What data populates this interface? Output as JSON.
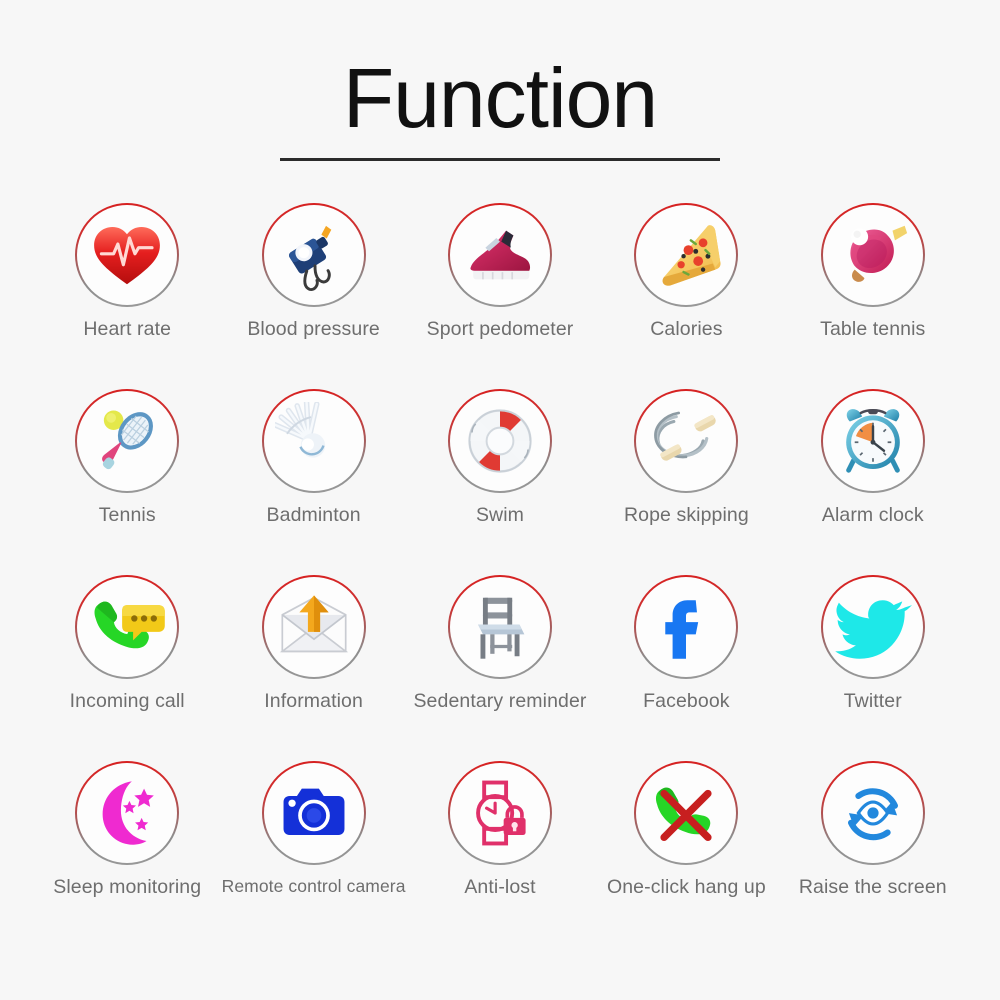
{
  "header": {
    "title": "Function"
  },
  "colors": {
    "background": "#f7f7f7",
    "ring_top": "#d81f1f",
    "ring_bottom": "#8d8d8d",
    "label_text": "#6e6e6e",
    "title_text": "#111111",
    "facebook_blue": "#1877f2",
    "twitter_cyan": "#1ee8e8",
    "sleep_magenta": "#ef2ad0",
    "camera_blue": "#1430d8",
    "phone_green": "#22cc22",
    "raise_blue": "#2288dd",
    "antilost_pink": "#e0306a"
  },
  "grid": {
    "columns": 5,
    "rows": 4,
    "items": [
      {
        "label": "Heart rate",
        "icon": "heart-rate-icon"
      },
      {
        "label": "Blood pressure",
        "icon": "blood-pressure-icon"
      },
      {
        "label": "Sport pedometer",
        "icon": "running-shoe-icon"
      },
      {
        "label": "Calories",
        "icon": "pizza-slice-icon"
      },
      {
        "label": "Table tennis",
        "icon": "table-tennis-icon"
      },
      {
        "label": "Tennis",
        "icon": "tennis-racket-icon"
      },
      {
        "label": "Badminton",
        "icon": "shuttlecock-icon"
      },
      {
        "label": "Swim",
        "icon": "life-ring-icon"
      },
      {
        "label": "Rope skipping",
        "icon": "jump-rope-icon"
      },
      {
        "label": "Alarm clock",
        "icon": "alarm-clock-icon"
      },
      {
        "label": "Incoming call",
        "icon": "incoming-call-icon"
      },
      {
        "label": "Information",
        "icon": "envelope-icon"
      },
      {
        "label": "Sedentary reminder",
        "icon": "chair-icon"
      },
      {
        "label": "Facebook",
        "icon": "facebook-icon"
      },
      {
        "label": "Twitter",
        "icon": "twitter-bird-icon"
      },
      {
        "label": "Sleep monitoring",
        "icon": "moon-stars-icon"
      },
      {
        "label": "Remote control camera",
        "icon": "camera-icon",
        "small": true
      },
      {
        "label": "Anti-lost",
        "icon": "watch-lock-icon"
      },
      {
        "label": "One-click hang up",
        "icon": "hang-up-icon"
      },
      {
        "label": "Raise the screen",
        "icon": "raise-screen-icon"
      }
    ]
  }
}
